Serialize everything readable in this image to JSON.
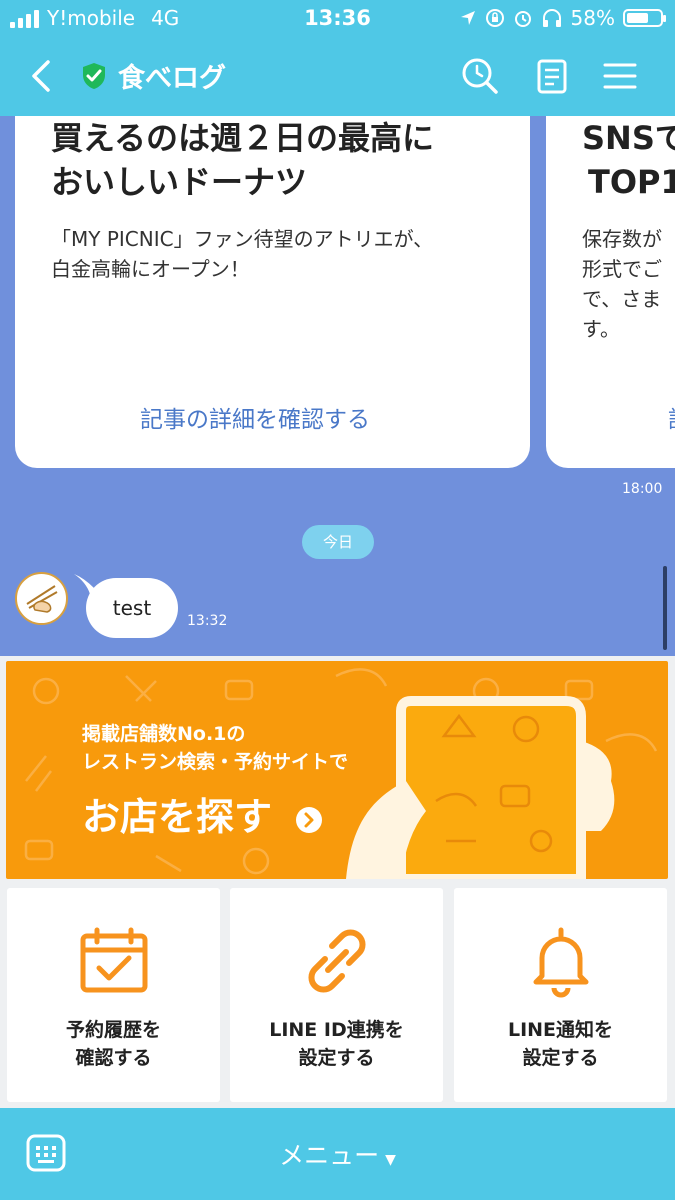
{
  "status": {
    "carrier": "Y!mobile",
    "network": "4G",
    "time": "13:36",
    "battery": "58%",
    "battery_level": 0.58
  },
  "nav": {
    "title": "食べログ",
    "icons": [
      "back-icon",
      "shield-check-icon",
      "search-icon",
      "notes-icon",
      "menu-icon"
    ]
  },
  "chat": {
    "cards": [
      {
        "title_line1": "買えるのは週２日の最高に",
        "title_line2": "おいしいドーナツ",
        "desc_line1": "「MY PICNIC」ファン待望のアトリエが、",
        "desc_line2": "白金高輪にオープン！",
        "link": "記事の詳細を確認する"
      },
      {
        "title_line1": "SNSで",
        "title_line2": "TOP1",
        "desc_line1": "保存数が",
        "desc_line2": "形式でご",
        "desc_line3": "で、さま",
        "desc_line4": "す。",
        "link": "記"
      }
    ],
    "card_time": "18:00",
    "date_label": "今日",
    "message_text": "test",
    "message_time": "13:32"
  },
  "richmenu": {
    "banner": {
      "line1": "掲載店舗数No.1の",
      "line2": "レストラン検索・予約サイトで",
      "cta": "お店を探す"
    },
    "tiles": [
      {
        "line1": "予約履歴を",
        "line2": "確認する",
        "icon": "calendar-check-icon"
      },
      {
        "line1": "LINE ID連携を",
        "line2": "設定する",
        "icon": "link-icon"
      },
      {
        "line1": "LINE通知を",
        "line2": "設定する",
        "icon": "bell-icon"
      }
    ],
    "accent": "#f7931e"
  },
  "bottom": {
    "menu_label": "メニュー"
  },
  "colors": {
    "header": "#4fc8e6",
    "chat_bg": "#7090dc",
    "banner": "#f89a0c",
    "link": "#4a78c8"
  }
}
